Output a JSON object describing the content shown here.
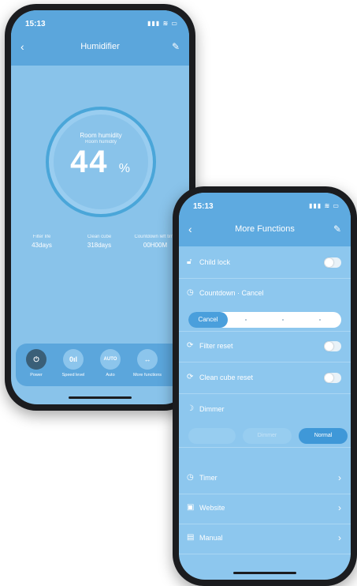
{
  "left_phone": {
    "status_time": "15:13",
    "nav_title": "Humidifier",
    "humidity": {
      "label": "Room humidity",
      "sublabel": "Room humidity",
      "value": "44",
      "unit": "%"
    },
    "stats": [
      {
        "label": "Filter life",
        "value": "43days"
      },
      {
        "label": "Clean cube",
        "value": "318days"
      },
      {
        "label": "Countdown left time",
        "value": "00H00M"
      }
    ],
    "buttons": [
      {
        "label": "Power",
        "icon": "power-icon",
        "glyph": "⏻"
      },
      {
        "label": "Speed level",
        "icon": "speed-level-icon",
        "glyph": "0ıl"
      },
      {
        "label": "Auto",
        "icon": "auto-icon",
        "glyph": "AUTO"
      },
      {
        "label": "More functions",
        "icon": "more-functions-icon",
        "glyph": "↔"
      }
    ]
  },
  "right_phone": {
    "status_time": "15:13",
    "nav_title": "More Functions",
    "child_lock": "Child lock",
    "countdown": {
      "label": "Countdown · Cancel",
      "selected": "Cancel"
    },
    "filter_reset": "Filter reset",
    "clean_cube_reset": "Clean cube reset",
    "dimmer": {
      "label": "Dimmer",
      "options": [
        "",
        "Dimmer",
        "Normal"
      ],
      "selected": "Normal"
    },
    "timer": "Timer",
    "website": "Website",
    "manual": "Manual"
  },
  "colors": {
    "header_blue": "#5ba6dc",
    "screen_blue": "#89c3ea",
    "accent_blue": "#4a9fdc"
  }
}
